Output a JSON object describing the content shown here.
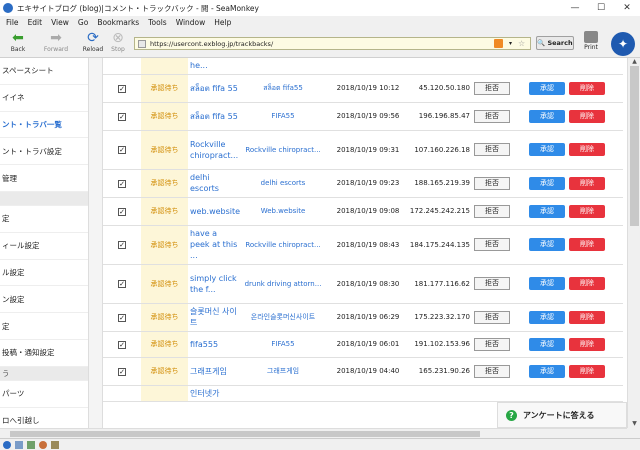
{
  "window": {
    "title": "エキサイトブログ (blog)|コメント・トラックバック - 閲 - SeaMonkey",
    "min": "—",
    "max": "☐",
    "close": "✕"
  },
  "menu": [
    "File",
    "Edit",
    "View",
    "Go",
    "Bookmarks",
    "Tools",
    "Window",
    "Help"
  ],
  "toolbar": {
    "back": "Back",
    "forward": "Forward",
    "reload": "Reload",
    "stop": "Stop",
    "search": "Search",
    "print": "Print"
  },
  "url": "https://usercont.exblog.jp/trackbacks/",
  "sidebar": {
    "items": [
      {
        "label": "スペースシート",
        "active": false,
        "section": false
      },
      {
        "label": "イイネ",
        "active": false,
        "section": false
      },
      {
        "label": "ント・トラバ一覧",
        "active": true,
        "section": false
      },
      {
        "label": "ント・トラバ設定",
        "active": false,
        "section": false
      },
      {
        "label": "管理",
        "active": false,
        "section": false
      },
      {
        "label": "",
        "active": false,
        "section": true
      },
      {
        "label": "定",
        "active": false,
        "section": false
      },
      {
        "label": "ィール設定",
        "active": false,
        "section": false
      },
      {
        "label": "ル設定",
        "active": false,
        "section": false
      },
      {
        "label": "ン設定",
        "active": false,
        "section": false
      },
      {
        "label": "定",
        "active": false,
        "section": false
      },
      {
        "label": "投稿・通知設定",
        "active": false,
        "section": false
      },
      {
        "label": "う",
        "active": false,
        "section": true
      },
      {
        "label": "パーツ",
        "active": false,
        "section": false
      },
      {
        "label": "ロへ引越し",
        "active": false,
        "section": false
      }
    ]
  },
  "labels": {
    "status": "承認待ち",
    "reject": "拒否",
    "approve": "承認",
    "delete": "削除"
  },
  "rows": [
    {
      "title": "he...",
      "blog": "",
      "date": "",
      "ip": "",
      "lines": 1,
      "partial": true
    },
    {
      "title": "สล็อต fifa 55",
      "blog": "สล็อต fifa55",
      "date": "2018/10/19 10:12",
      "ip": "45.120.50.180",
      "lines": 2
    },
    {
      "title": "สล็อต fifa 55",
      "blog": "FIFA55",
      "date": "2018/10/19 09:56",
      "ip": "196.196.85.47",
      "lines": 2
    },
    {
      "title": "Rockville chiropract...",
      "blog": "Rockville chiropract...",
      "date": "2018/10/19 09:31",
      "ip": "107.160.226.18",
      "lines": 3
    },
    {
      "title": "delhi escorts",
      "blog": "delhi escorts",
      "date": "2018/10/19 09:23",
      "ip": "188.165.219.39",
      "lines": 2
    },
    {
      "title": "web.website",
      "blog": "Web.website",
      "date": "2018/10/19 09:08",
      "ip": "172.245.242.215",
      "lines": 2
    },
    {
      "title": "have a peek at this ...",
      "blog": "Rockville chiropract...",
      "date": "2018/10/19 08:43",
      "ip": "184.175.244.135",
      "lines": 3
    },
    {
      "title": "simply click the f...",
      "blog": "drunk driving attorn...",
      "date": "2018/10/19 08:30",
      "ip": "181.177.116.62",
      "lines": 3
    },
    {
      "title": "슬롯머신 사이트",
      "blog": "온라인슬롯머신사이트",
      "date": "2018/10/19 06:29",
      "ip": "175.223.32.170",
      "lines": 2
    },
    {
      "title": "fifa555",
      "blog": "FIFA55",
      "date": "2018/10/19 06:01",
      "ip": "191.102.153.96",
      "lines": 1
    },
    {
      "title": "그래프게임",
      "blog": "그래프게임",
      "date": "2018/10/19 04:40",
      "ip": "165.231.90.26",
      "lines": 2
    },
    {
      "title": "인터넷가",
      "blog": "",
      "date": "",
      "ip": "",
      "lines": 1,
      "partial": true
    }
  ],
  "survey": "アンケートに答える"
}
